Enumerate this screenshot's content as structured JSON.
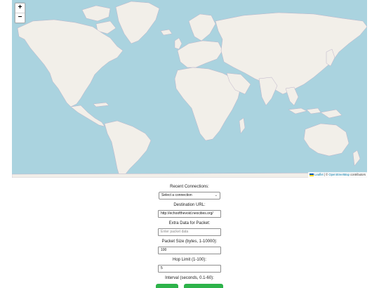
{
  "map": {
    "zoom_in": "+",
    "zoom_out": "−",
    "attribution": {
      "leaflet": "Leaflet",
      "separator": " | © ",
      "osm": "OpenStreetMap",
      "suffix": " contributors"
    },
    "colors": {
      "ocean": "#aad3df",
      "land": "#f2efe9",
      "border": "#bdb3c9"
    }
  },
  "form": {
    "recent_label": "Recent Connections:",
    "recent_selected": "Select a connection",
    "destination_label": "Destination URL:",
    "destination_value": "http://echoofthevoid.neocities.org/",
    "extra_label": "Extra Data for Packet:",
    "extra_placeholder": "Enter packet data",
    "size_label": "Packet Size (bytes, 1-10000):",
    "size_value": "100",
    "hop_label": "Hop Limit (1-100):",
    "hop_value": "5",
    "interval_label": "Interval (seconds, 0.1-60):",
    "button_color": "#2db34a"
  }
}
